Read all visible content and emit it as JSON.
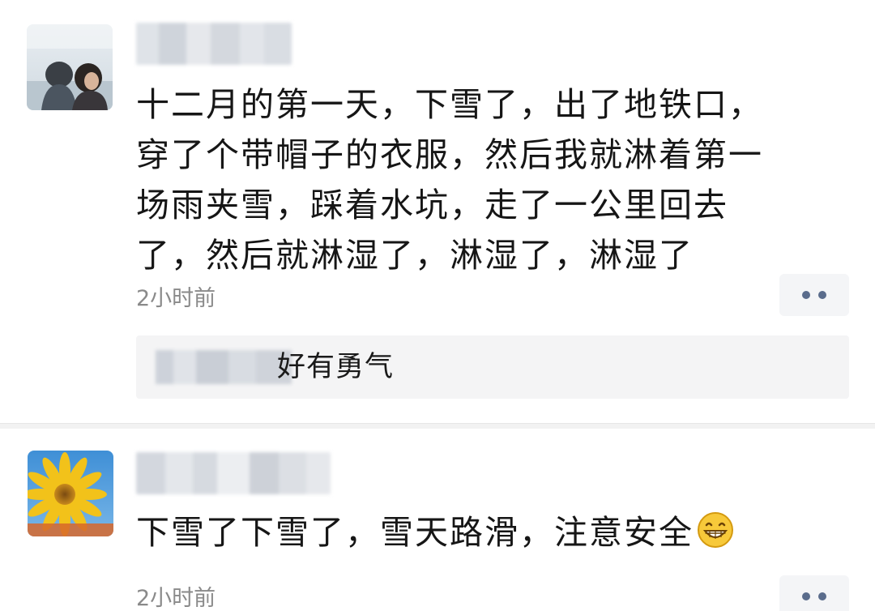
{
  "posts": [
    {
      "content": "十二月的第一天，下雪了，出了地铁口，\n穿了个带帽子的衣服，然后我就淋着第一\n场雨夹雪，踩着水坑，走了一公里回去\n了，然后就淋湿了，淋湿了，淋湿了",
      "time": "2小时前",
      "more_icon": "more-dots-icon",
      "comment": {
        "text": "好有勇气"
      }
    },
    {
      "content": "下雪了下雪了，雪天路滑，注意安全",
      "emoji": "grinning-face-icon",
      "time": "2小时前",
      "more_icon": "more-dots-icon"
    }
  ],
  "colors": {
    "text": "#161616",
    "time": "#8a8a8a",
    "more_dots": "#5a6c8c",
    "panel_bg": "#f4f4f5"
  }
}
